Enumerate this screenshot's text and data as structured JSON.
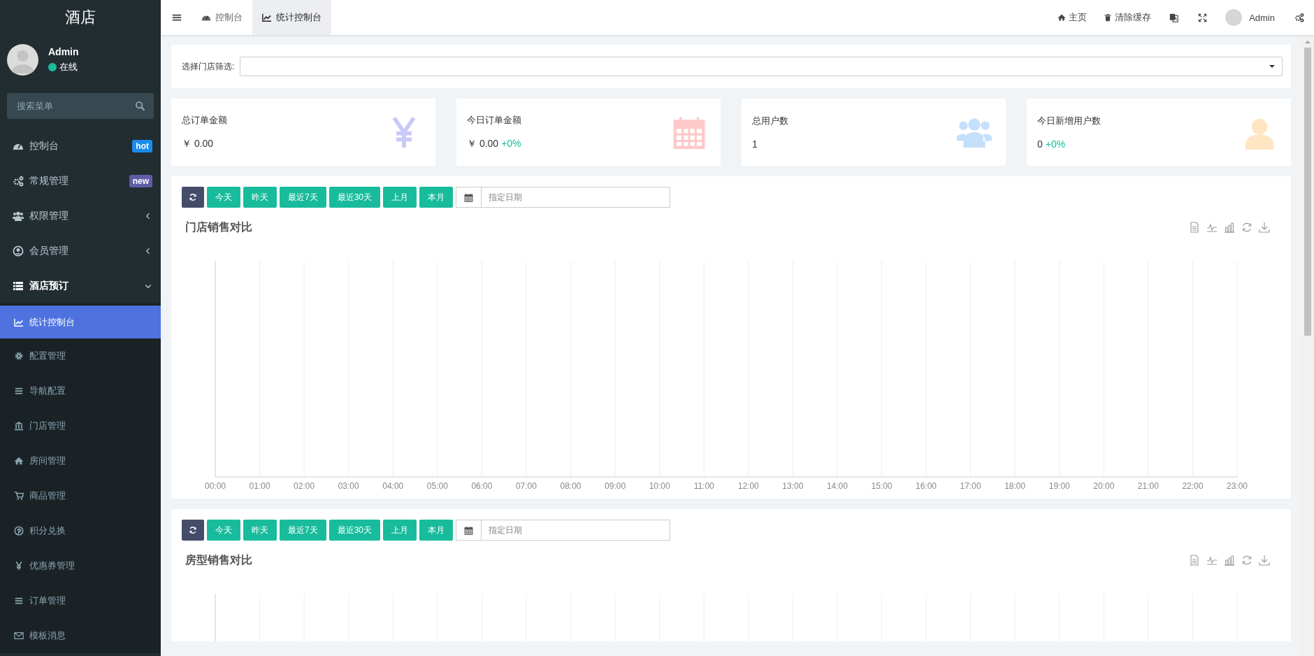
{
  "sidebar": {
    "logo": "酒店",
    "user": {
      "name": "Admin",
      "status": "在线",
      "online": true
    },
    "search": {
      "placeholder": "搜索菜单"
    },
    "items": [
      {
        "label": "控制台",
        "selected": false,
        "badge": {
          "text": "hot",
          "color": "#1a8ceb"
        }
      },
      {
        "label": "常规管理",
        "selected": false,
        "badge": {
          "text": "new",
          "color": "#605ca8"
        }
      },
      {
        "label": "权限管理",
        "selected": false,
        "expanded": false
      },
      {
        "label": "会员管理",
        "selected": false,
        "expanded": false
      },
      {
        "label": "酒店预订",
        "selected": false,
        "expanded": true,
        "children": [
          {
            "label": "统计控制台",
            "selected": true
          },
          {
            "label": "配置管理",
            "selected": false
          },
          {
            "label": "导航配置",
            "selected": false
          },
          {
            "label": "门店管理",
            "selected": false
          },
          {
            "label": "房间管理",
            "selected": false
          },
          {
            "label": "商品管理",
            "selected": false
          },
          {
            "label": "积分兑换",
            "selected": false
          },
          {
            "label": "优惠券管理",
            "selected": false
          },
          {
            "label": "订单管理",
            "selected": false
          },
          {
            "label": "模板消息",
            "selected": false
          }
        ]
      }
    ]
  },
  "header": {
    "tabs": [
      {
        "label": "控制台",
        "selected": false
      },
      {
        "label": "统计控制台",
        "selected": true
      }
    ],
    "links": [
      "主页",
      "清除缓存"
    ],
    "user": "Admin"
  },
  "filter": {
    "label": "选择门店筛选:"
  },
  "cards": [
    {
      "title": "总订单金额",
      "value": "￥ 0.00",
      "color": "#c8c9f8"
    },
    {
      "title": "今日订单金额",
      "value": "￥ 0.00",
      "change": "+0%",
      "color": "#ffc9c9"
    },
    {
      "title": "总用户数",
      "value": "1",
      "color": "#c5e0fb"
    },
    {
      "title": "今日新增用户数",
      "value": "0",
      "change": "+0%",
      "color": "#ffe5c2"
    }
  ],
  "panels": [
    {
      "buttons": [
        "今天",
        "昨天",
        "最近7天",
        "最近30天",
        "上月",
        "本月"
      ],
      "date_placeholder": "指定日期",
      "chart": {
        "title": "门店销售对比",
        "x_labels": [
          "00:00",
          "01:00",
          "02:00",
          "03:00",
          "04:00",
          "05:00",
          "06:00",
          "07:00",
          "08:00",
          "09:00",
          "10:00",
          "11:00",
          "12:00",
          "13:00",
          "14:00",
          "15:00",
          "16:00",
          "17:00",
          "18:00",
          "19:00",
          "20:00",
          "21:00",
          "22:00",
          "23:00"
        ]
      }
    },
    {
      "buttons": [
        "今天",
        "昨天",
        "最近7天",
        "最近30天",
        "上月",
        "本月"
      ],
      "date_placeholder": "指定日期",
      "chart": {
        "title": "房型销售对比"
      }
    }
  ]
}
